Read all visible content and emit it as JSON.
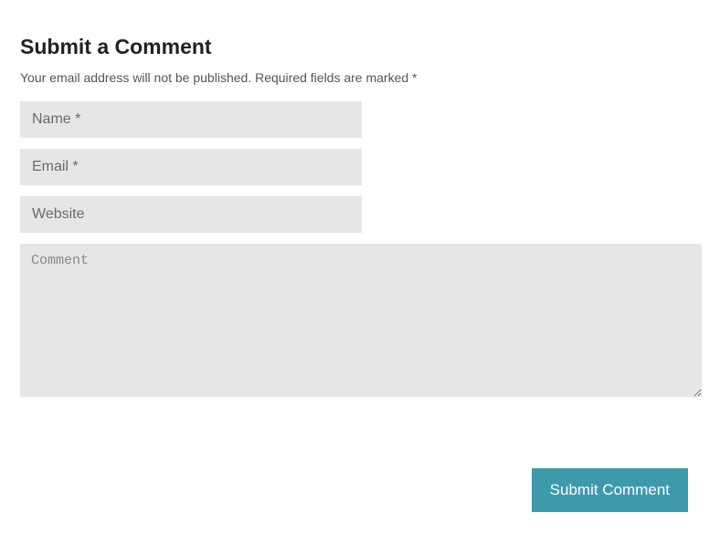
{
  "form": {
    "title": "Submit a Comment",
    "description": "Your email address will not be published. Required fields are marked *",
    "name_placeholder": "Name *",
    "email_placeholder": "Email *",
    "website_placeholder": "Website",
    "comment_placeholder": "Comment",
    "submit_label": "Submit Comment"
  }
}
